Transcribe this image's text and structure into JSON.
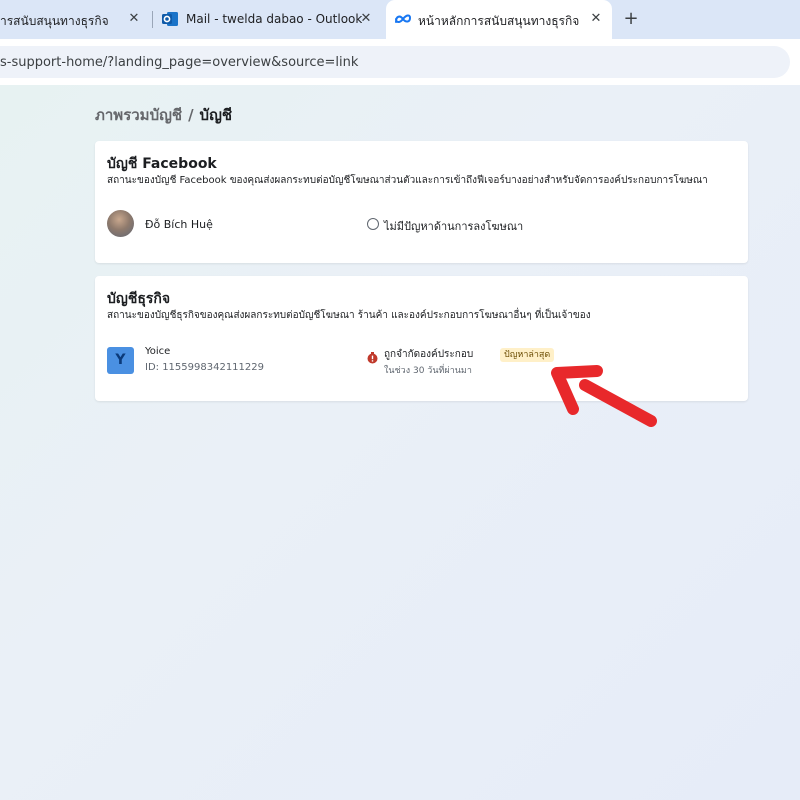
{
  "browser": {
    "tabs": [
      {
        "title": "ารสนับสนุนทางธุรกิจ",
        "active": false
      },
      {
        "title": "Mail - twelda dabao - Outlook",
        "icon": "outlook-icon",
        "active": false
      },
      {
        "title": "หน้าหลักการสนับสนุนทางธุรกิจ",
        "icon": "meta-icon",
        "active": true
      }
    ],
    "close_glyph": "✕",
    "new_tab_glyph": "+",
    "url": "s-support-home/?landing_page=overview&source=link"
  },
  "breadcrumb": {
    "parent": "ภาพรวมบัญชี",
    "separator": "/",
    "current": "บัญชี"
  },
  "facebook_card": {
    "title": "บัญชี Facebook",
    "description": "สถานะของบัญชี Facebook ของคุณส่งผลกระทบต่อบัญชีโฆษณาส่วนตัวและการเข้าถึงฟีเจอร์บางอย่างสำหรับจัดการองค์ประกอบการโฆษณา",
    "person_name": "Đỗ Bích Huệ",
    "status": "ไม่มีปัญหาด้านการลงโฆษณา"
  },
  "business_card": {
    "title": "บัญชีธุรกิจ",
    "description": "สถานะของบัญชีธุรกิจของคุณส่งผลกระทบต่อบัญชีโฆษณา ร้านค้า และองค์ประกอบการโฆษณาอื่นๆ ที่เป็นเจ้าของ",
    "logo_letter": "Y",
    "business_name": "Yoice",
    "business_id": "ID: 1155998342111229",
    "restriction": "ถูกจำกัดองค์ประกอบ",
    "restriction_period": "ในช่วง 30 วันที่ผ่านมา",
    "badge": "ปัญหาล่าสุด"
  },
  "colors": {
    "tab_strip": "#dbe6f7",
    "logo_blue": "#4a90e2",
    "badge_bg": "#fff0c8",
    "annotation_arrow": "#e8282b",
    "warning": "#c0392b"
  }
}
